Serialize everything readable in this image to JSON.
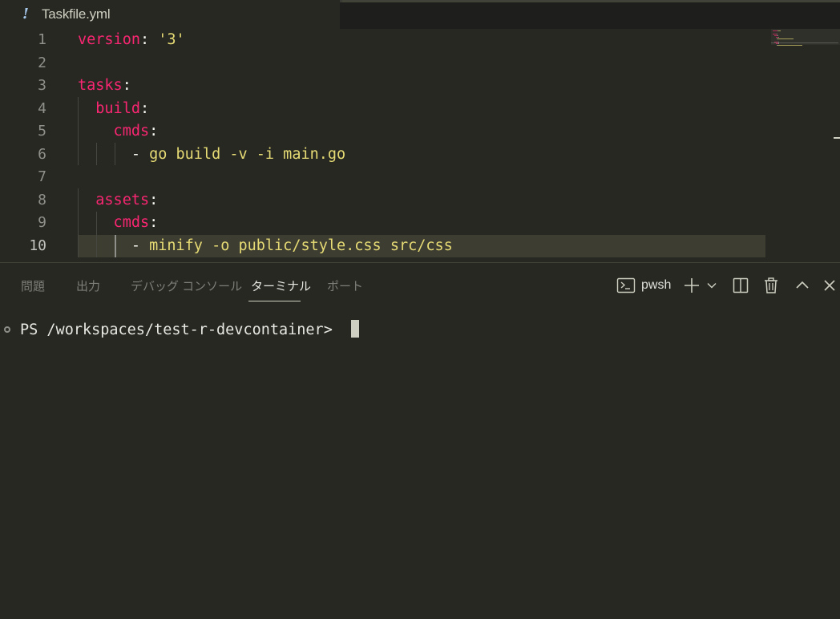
{
  "tab": {
    "icon": "yaml-icon",
    "icon_glyph": "!",
    "filename": "Taskfile.yml"
  },
  "editor": {
    "active_line": 10,
    "lines": [
      {
        "number": "1",
        "tokens": [
          {
            "t": "version",
            "c": "key"
          },
          {
            "t": ": ",
            "c": "punct"
          },
          {
            "t": "'3'",
            "c": "str"
          }
        ]
      },
      {
        "number": "2",
        "tokens": []
      },
      {
        "number": "3",
        "tokens": [
          {
            "t": "tasks",
            "c": "key"
          },
          {
            "t": ":",
            "c": "punct"
          }
        ]
      },
      {
        "number": "4",
        "tokens": [
          {
            "t": "  build",
            "c": "key"
          },
          {
            "t": ":",
            "c": "punct"
          }
        ]
      },
      {
        "number": "5",
        "tokens": [
          {
            "t": "    cmds",
            "c": "key"
          },
          {
            "t": ":",
            "c": "punct"
          }
        ]
      },
      {
        "number": "6",
        "tokens": [
          {
            "t": "      - ",
            "c": "punct"
          },
          {
            "t": "go build -v -i main.go",
            "c": "str"
          }
        ]
      },
      {
        "number": "7",
        "tokens": []
      },
      {
        "number": "8",
        "tokens": [
          {
            "t": "  assets",
            "c": "key"
          },
          {
            "t": ":",
            "c": "punct"
          }
        ]
      },
      {
        "number": "9",
        "tokens": [
          {
            "t": "    cmds",
            "c": "key"
          },
          {
            "t": ":",
            "c": "punct"
          }
        ]
      },
      {
        "number": "10",
        "tokens": [
          {
            "t": "      - ",
            "c": "punct"
          },
          {
            "t": "minify -o public/style.css src/css",
            "c": "str"
          }
        ]
      }
    ]
  },
  "panel": {
    "tabs": [
      {
        "label": "問題",
        "active": false
      },
      {
        "label": "出力",
        "active": false
      },
      {
        "label": "デバッグ コンソール",
        "active": false
      },
      {
        "label": "ターミナル",
        "active": true
      },
      {
        "label": "ポート",
        "active": false
      }
    ],
    "actions": {
      "terminal_profile": "pwsh",
      "profile_icon": "terminal-icon",
      "new_terminal_icon": "plus-icon",
      "dropdown_icon": "chevron-down-icon",
      "split_icon": "split-icon",
      "kill_icon": "trash-icon",
      "maximize_icon": "chevron-up-icon",
      "close_icon": "close-icon"
    }
  },
  "terminal": {
    "prompt": "PS /workspaces/test-r-devcontainer> "
  },
  "colors": {
    "background": "#272822",
    "keyword": "#f92672",
    "string": "#e6db74",
    "line_highlight": "#3e3d32"
  }
}
